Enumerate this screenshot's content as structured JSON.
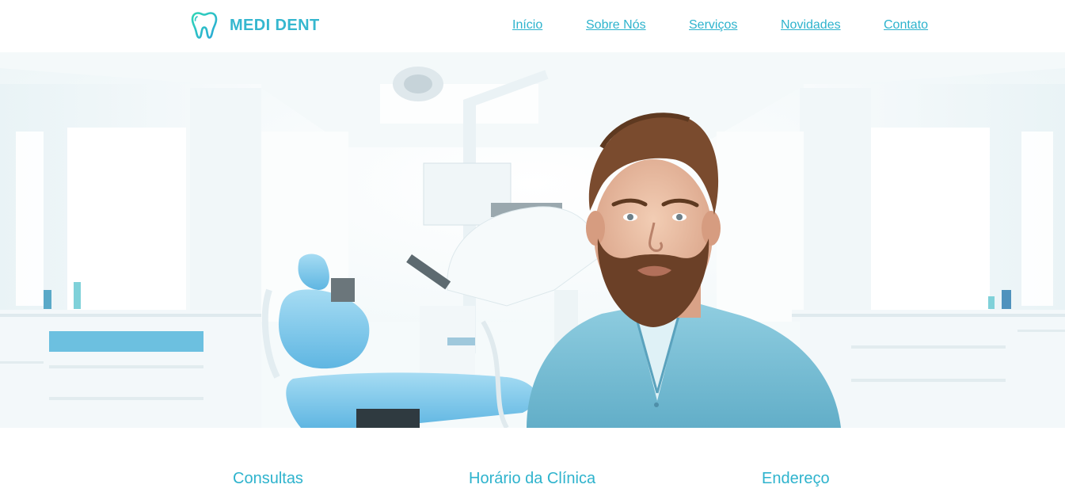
{
  "brand": {
    "name": "MEDI DENT",
    "icon": "tooth-icon",
    "color": "#35b7cf"
  },
  "nav": {
    "items": [
      {
        "label": "Início"
      },
      {
        "label": "Sobre Nós"
      },
      {
        "label": "Serviços"
      },
      {
        "label": "Novidades"
      },
      {
        "label": "Contato"
      }
    ],
    "link_color": "#2eb3cd"
  },
  "hero": {
    "image": "dentist-in-clinic-photo"
  },
  "info": {
    "consultas": "Consultas",
    "horario": "Horário da Clínica",
    "endereco": "Endereço"
  }
}
